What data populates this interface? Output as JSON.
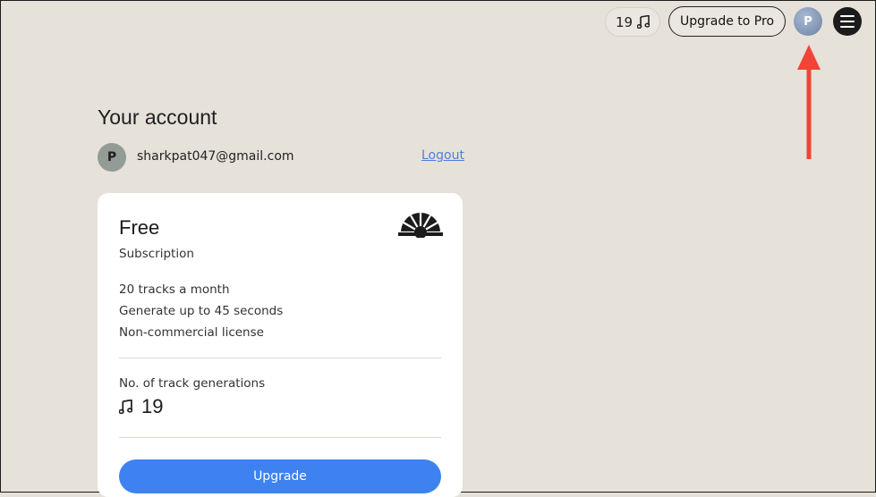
{
  "topbar": {
    "credits_count": "19",
    "upgrade_label": "Upgrade to Pro",
    "avatar_initial": "P"
  },
  "account": {
    "title": "Your account",
    "avatar_initial": "P",
    "email": "sharkpat047@gmail.com",
    "logout_label": "Logout"
  },
  "plan": {
    "name": "Free",
    "subtitle": "Subscription",
    "features": [
      "20 tracks a month",
      "Generate up to 45 seconds",
      "Non-commercial license"
    ],
    "generations_label": "No. of track generations",
    "generations_value": "19",
    "upgrade_label": "Upgrade"
  },
  "colors": {
    "background": "#e6e1d9",
    "accent": "#3d82f0",
    "annotation": "#f04437",
    "link": "#4f7fe0"
  },
  "icons": {
    "credits": "music-note-icon",
    "menu": "hamburger-menu-icon",
    "logo": "sunburst-logo-icon",
    "annotation": "red-arrow-up"
  }
}
